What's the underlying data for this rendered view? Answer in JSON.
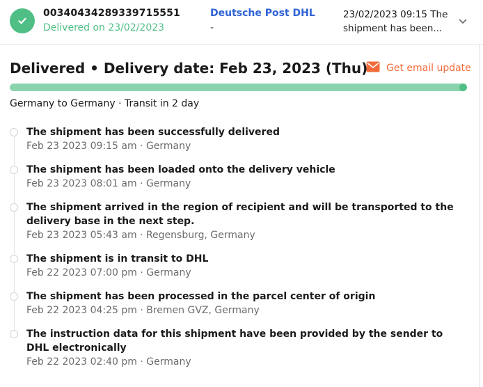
{
  "header": {
    "tracking_number": "00340434289339715551",
    "status_text": "Delivered on 23/02/2023",
    "carrier": "Deutsche Post DHL",
    "carrier_sub": "-",
    "latest_event_line1": "23/02/2023 09:15 The",
    "latest_event_line2": "shipment has been..."
  },
  "summary": {
    "title": "Delivered • Delivery date: Feb 23, 2023 (Thu)",
    "email_update_label": "Get email update",
    "progress_fraction": 1.0,
    "route_text": "Germany to Germany · Transit in 2 day"
  },
  "events": [
    {
      "title": "The shipment has been successfully delivered",
      "meta": "Feb 23 2023 09:15 am · Germany"
    },
    {
      "title": "The shipment has been loaded onto the delivery vehicle",
      "meta": "Feb 23 2023 08:01 am · Germany"
    },
    {
      "title": "The shipment arrived in the region of recipient and will be transported to the delivery base in the next step.",
      "meta": "Feb 23 2023 05:43 am · Regensburg, Germany"
    },
    {
      "title": "The shipment is in transit to DHL",
      "meta": "Feb 22 2023 07:00 pm · Germany"
    },
    {
      "title": "The shipment has been processed in the parcel center of origin",
      "meta": "Feb 22 2023 04:25 pm · Bremen GVZ, Germany"
    },
    {
      "title": "The instruction data for this shipment have been provided by the sender to DHL electronically",
      "meta": "Feb 22 2023 02:40 pm · Germany"
    }
  ],
  "colors": {
    "delivered_green": "#4fbf85",
    "progress_fill": "#8bd3ad",
    "carrier_blue": "#2f62d6",
    "email_orange": "#f26b3a"
  },
  "icons": {
    "status": "checkmark-icon",
    "expand": "chevron-down-icon",
    "email": "envelope-icon"
  }
}
